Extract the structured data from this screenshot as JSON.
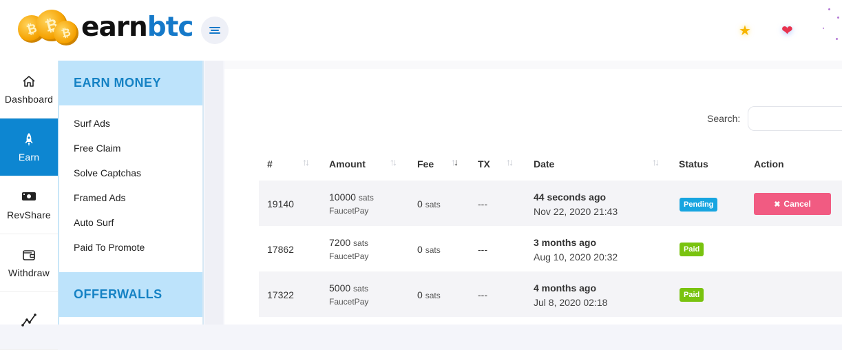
{
  "header": {
    "logo_earn": "earn",
    "logo_btc": "btc",
    "coin_symbol": "₿",
    "icons": [
      "menu-icon",
      "star-icon",
      "heart-icon"
    ]
  },
  "rail": {
    "items": [
      {
        "label": "Dashboard",
        "icon": "home-icon",
        "active": false
      },
      {
        "label": "Earn",
        "icon": "rocket-icon",
        "active": true
      },
      {
        "label": "RevShare",
        "icon": "money-icon",
        "active": false
      },
      {
        "label": "Withdraw",
        "icon": "wallet-icon",
        "active": false
      },
      {
        "label": "",
        "icon": "chart-line-icon",
        "active": false
      }
    ]
  },
  "submenu": {
    "heading": "EARN MONEY",
    "items": [
      "Surf Ads",
      "Free Claim",
      "Solve Captchas",
      "Framed Ads",
      "Auto Surf",
      "Paid To Promote"
    ],
    "heading2": "OFFERWALLS"
  },
  "search": {
    "label": "Search:",
    "value": ""
  },
  "table": {
    "columns": [
      "#",
      "Amount",
      "Fee",
      "TX",
      "Date",
      "Status",
      "Action"
    ],
    "rows": [
      {
        "id": "19140",
        "amount": "10000",
        "amount_unit": "sats",
        "method": "FaucetPay",
        "fee": "0",
        "fee_unit": "sats",
        "tx": "---",
        "date_rel": "44 seconds ago",
        "date_abs": "Nov 22, 2020 21:43",
        "status": "Pending",
        "action": "Cancel"
      },
      {
        "id": "17862",
        "amount": "7200",
        "amount_unit": "sats",
        "method": "FaucetPay",
        "fee": "0",
        "fee_unit": "sats",
        "tx": "---",
        "date_rel": "3 months ago",
        "date_abs": "Aug 10, 2020 20:32",
        "status": "Paid",
        "action": ""
      },
      {
        "id": "17322",
        "amount": "5000",
        "amount_unit": "sats",
        "method": "FaucetPay",
        "fee": "0",
        "fee_unit": "sats",
        "tx": "---",
        "date_rel": "4 months ago",
        "date_abs": "Jul 8, 2020 02:18",
        "status": "Paid",
        "action": ""
      }
    ]
  },
  "colors": {
    "brand_blue": "#1579c9",
    "rail_active": "#0d86d1",
    "submenu_head_bg": "#bde3fb",
    "pending": "#17a5e0",
    "paid": "#79c30f",
    "cancel": "#f15b82"
  }
}
